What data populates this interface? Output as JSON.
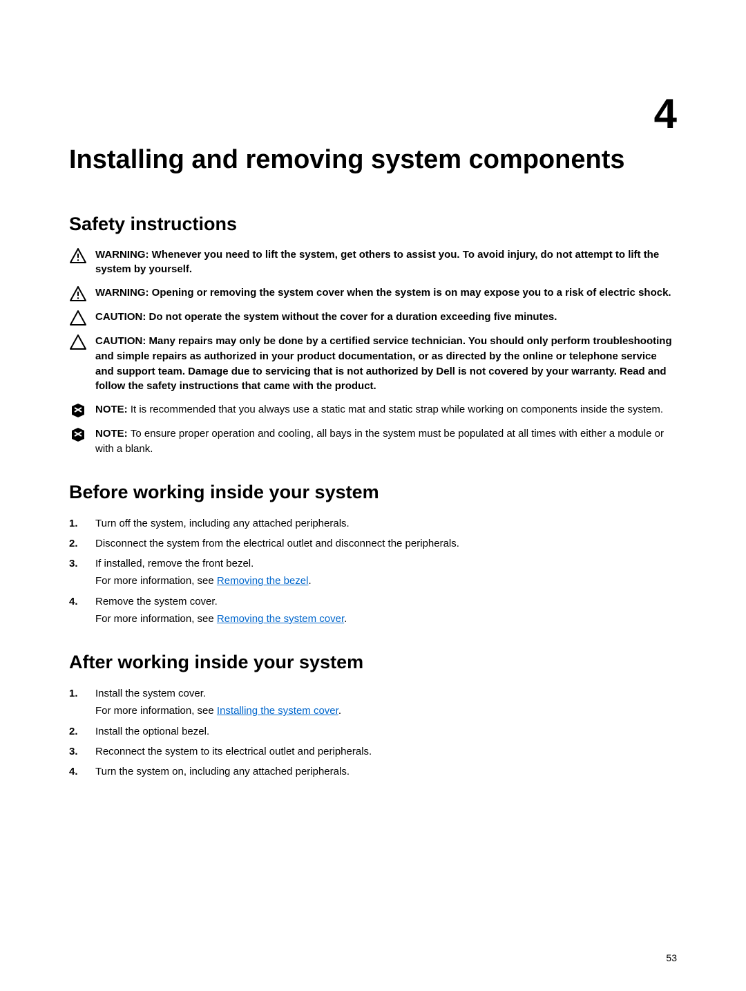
{
  "chapter_number": "4",
  "title": "Installing and removing system components",
  "page_number": "53",
  "safety": {
    "heading": "Safety instructions",
    "warn1_lead": "WARNING: ",
    "warn1_body": "Whenever you need to lift the system, get others to assist you. To avoid injury, do not attempt to lift the system by yourself.",
    "warn2_lead": "WARNING: ",
    "warn2_body": "Opening or removing the system cover when the system is on may expose you to a risk of electric shock.",
    "caut1_lead": "CAUTION: ",
    "caut1_body": "Do not operate the system without the cover for a duration exceeding five minutes.",
    "caut2_lead": "CAUTION: ",
    "caut2_body": "Many repairs may only be done by a certified service technician. You should only perform troubleshooting and simple repairs as authorized in your product documentation, or as directed by the online or telephone service and support team. Damage due to servicing that is not authorized by Dell is not covered by your warranty. Read and follow the safety instructions that came with the product.",
    "note1_lead": "NOTE: ",
    "note1_body": "It is recommended that you always use a static mat and static strap while working on components inside the system.",
    "note2_lead": "NOTE: ",
    "note2_body": "To ensure proper operation and cooling, all bays in the system must be populated at all times with either a module or with a blank."
  },
  "before": {
    "heading": "Before working inside your system",
    "step1": "Turn off the system, including any attached peripherals.",
    "step2": "Disconnect the system from the electrical outlet and disconnect the peripherals.",
    "step3": "If installed, remove the front bezel.",
    "step3_sub_prefix": "For more information, see ",
    "step3_link": "Removing the bezel",
    "step3_sub_suffix": ".",
    "step4": "Remove the system cover.",
    "step4_sub_prefix": "For more information, see ",
    "step4_link": "Removing the system cover",
    "step4_sub_suffix": "."
  },
  "after": {
    "heading": "After working inside your system",
    "step1": "Install the system cover.",
    "step1_sub_prefix": "For more information, see ",
    "step1_link": "Installing the system cover",
    "step1_sub_suffix": ".",
    "step2": "Install the optional bezel.",
    "step3": "Reconnect the system to its electrical outlet and peripherals.",
    "step4": "Turn the system on, including any attached peripherals."
  }
}
